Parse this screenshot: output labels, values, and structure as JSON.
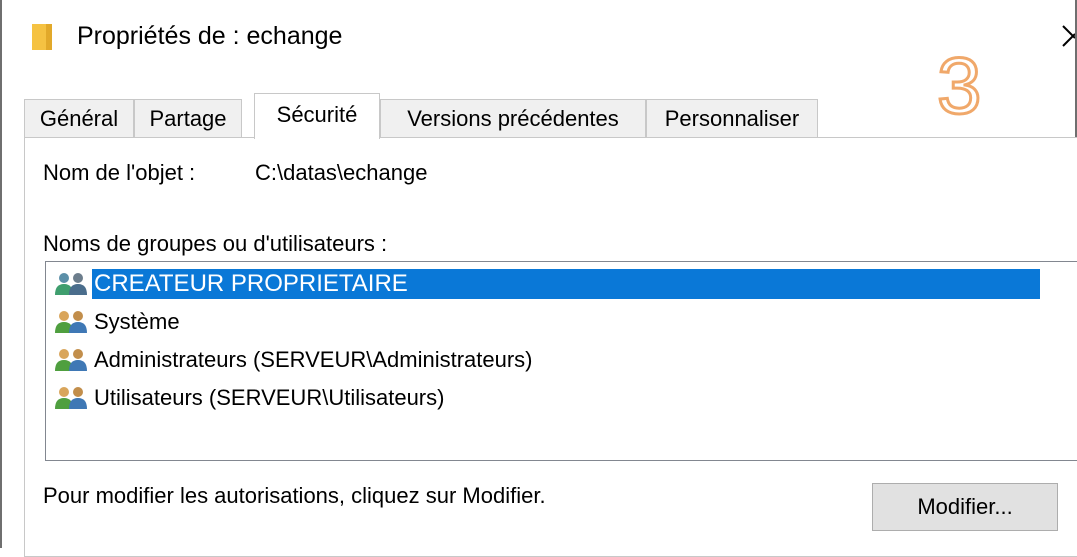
{
  "window": {
    "title": "Propriétés de : echange",
    "step_marker": "3"
  },
  "tabs": [
    {
      "label": "Général",
      "active": false
    },
    {
      "label": "Partage",
      "active": false
    },
    {
      "label": "Sécurité",
      "active": true
    },
    {
      "label": "Versions précédentes",
      "active": false
    },
    {
      "label": "Personnaliser",
      "active": false
    }
  ],
  "security": {
    "object_name_label": "Nom de l'objet :",
    "object_name_value": "C:\\datas\\echange",
    "groups_label": "Noms de groupes ou d'utilisateurs :",
    "principals": [
      {
        "name": "CREATEUR PROPRIETAIRE",
        "icon": "users-group-icon",
        "selected": true
      },
      {
        "name": "Système",
        "icon": "users-group-icon",
        "selected": false
      },
      {
        "name": "Administrateurs (SERVEUR\\Administrateurs)",
        "icon": "users-group-icon",
        "selected": false
      },
      {
        "name": "Utilisateurs (SERVEUR\\Utilisateurs)",
        "icon": "users-group-icon",
        "selected": false
      }
    ],
    "modify_hint": "Pour modifier les autorisations, cliquez sur Modifier.",
    "modify_button": "Modifier..."
  },
  "colors": {
    "selection": "#0a78d7",
    "step_marker": "#f0a86a",
    "folder": "#f5c242"
  }
}
